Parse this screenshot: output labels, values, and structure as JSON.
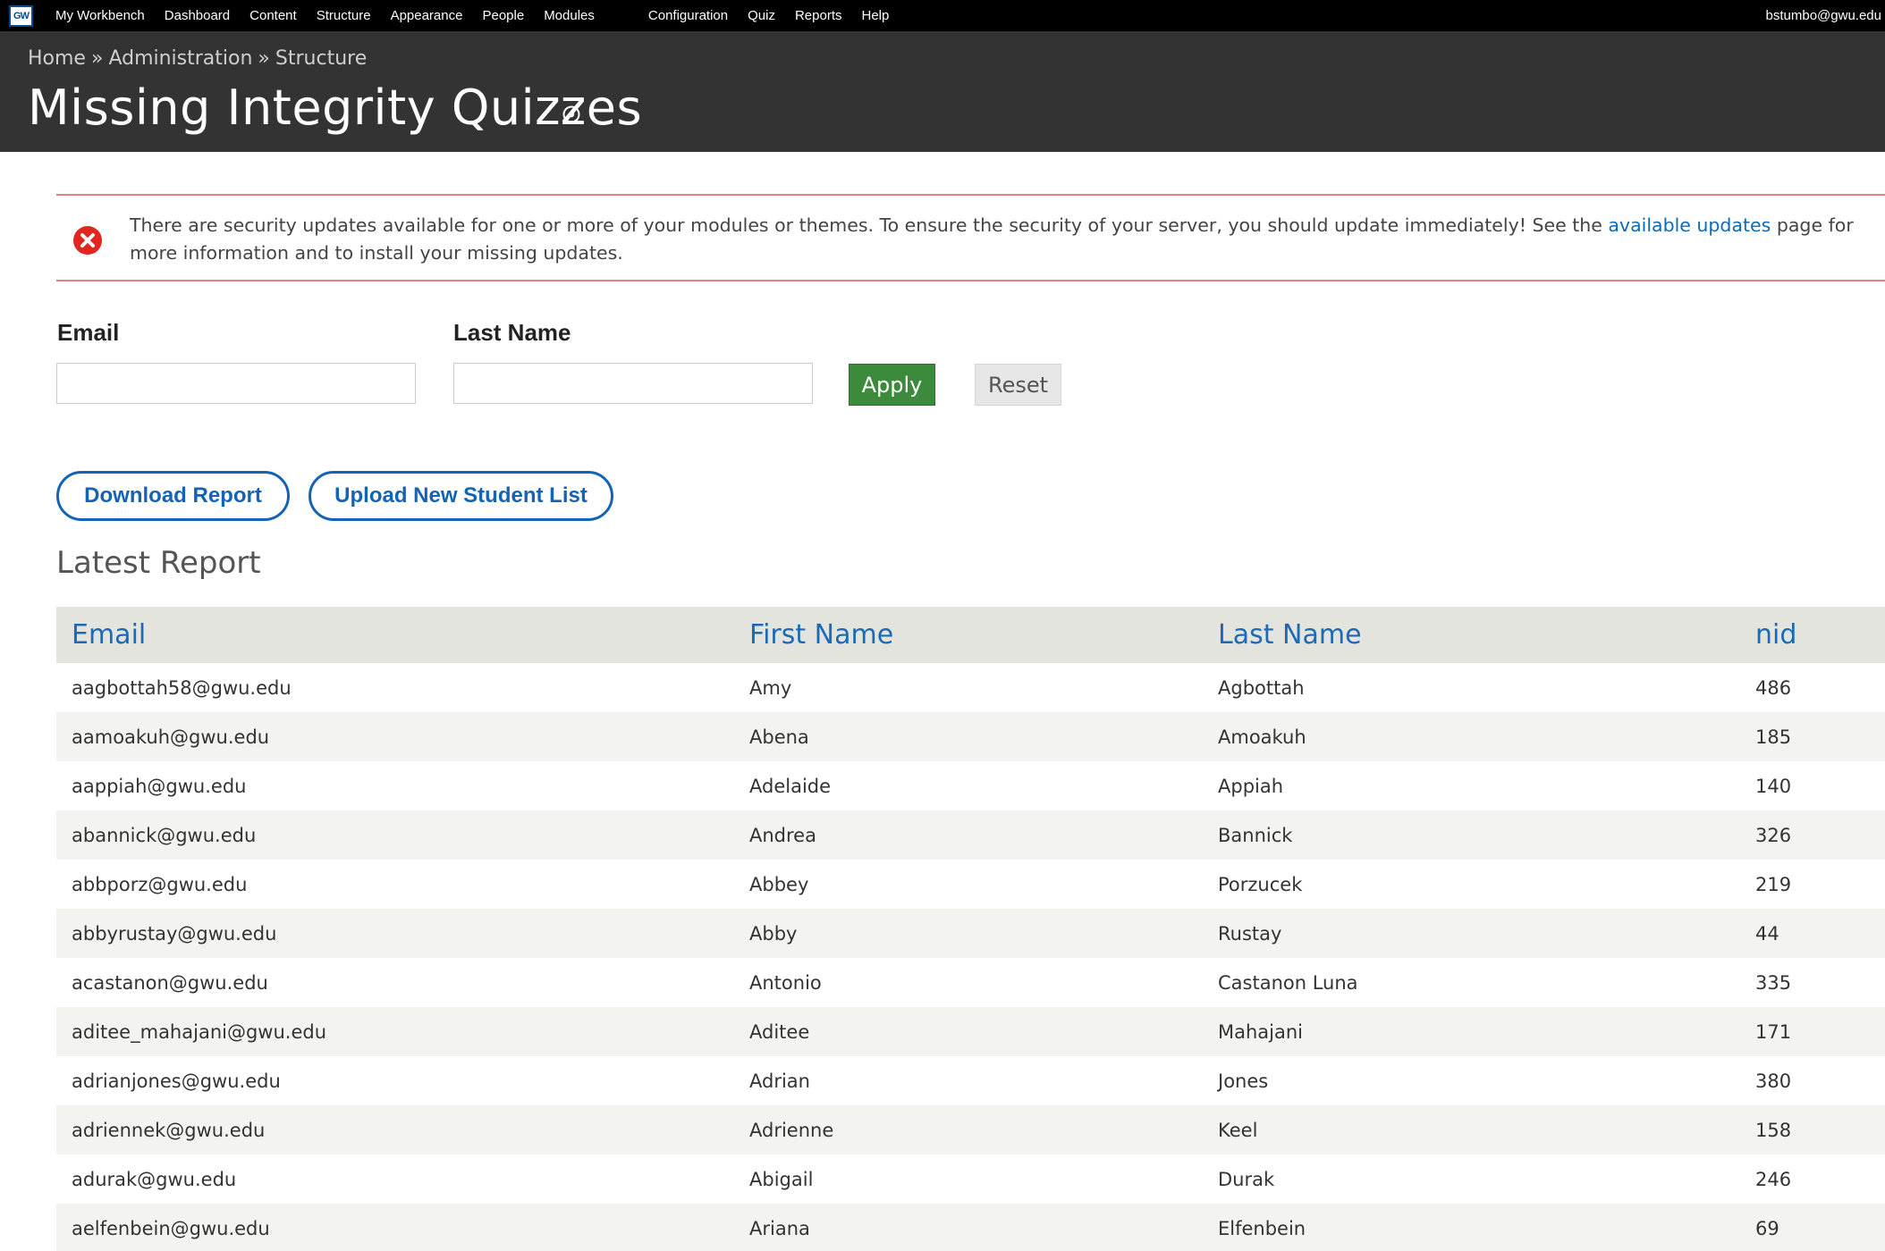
{
  "toolbar": {
    "logo": "GW",
    "items": [
      "My Workbench",
      "Dashboard",
      "Content",
      "Structure",
      "Appearance",
      "People",
      "Modules",
      "Configuration",
      "Quiz",
      "Reports",
      "Help"
    ],
    "user": "bstumbo@gwu.edu"
  },
  "header": {
    "breadcrumb": [
      "Home",
      "Administration",
      "Structure"
    ],
    "breadcrumb_separator": "»",
    "title": "Missing Integrity Quizzes"
  },
  "message": {
    "text_before": "There are security updates available for one or more of your modules or themes. To ensure the security of your server, you should update immediately! See the ",
    "link_text": "available updates",
    "text_after": " page for more information and to install your missing updates."
  },
  "filters": {
    "email_label": "Email",
    "email_value": "",
    "last_name_label": "Last Name",
    "last_name_value": "",
    "apply_label": "Apply",
    "reset_label": "Reset"
  },
  "actions": {
    "download_label": "Download Report",
    "upload_label": "Upload New Student List"
  },
  "report": {
    "title": "Latest Report",
    "columns": [
      "Email",
      "First Name",
      "Last Name",
      "nid"
    ],
    "rows": [
      {
        "email": "aagbottah58@gwu.edu",
        "first": "Amy",
        "last": "Agbottah",
        "nid": "486"
      },
      {
        "email": "aamoakuh@gwu.edu",
        "first": "Abena",
        "last": "Amoakuh",
        "nid": "185"
      },
      {
        "email": "aappiah@gwu.edu",
        "first": "Adelaide",
        "last": "Appiah",
        "nid": "140"
      },
      {
        "email": "abannick@gwu.edu",
        "first": "Andrea",
        "last": "Bannick",
        "nid": "326"
      },
      {
        "email": "abbporz@gwu.edu",
        "first": "Abbey",
        "last": "Porzucek",
        "nid": "219"
      },
      {
        "email": "abbyrustay@gwu.edu",
        "first": "Abby",
        "last": "Rustay",
        "nid": "44"
      },
      {
        "email": "acastanon@gwu.edu",
        "first": "Antonio",
        "last": "Castanon Luna",
        "nid": "335"
      },
      {
        "email": "aditee_mahajani@gwu.edu",
        "first": "Aditee",
        "last": "Mahajani",
        "nid": "171"
      },
      {
        "email": "adrianjones@gwu.edu",
        "first": "Adrian",
        "last": "Jones",
        "nid": "380"
      },
      {
        "email": "adriennek@gwu.edu",
        "first": "Adrienne",
        "last": "Keel",
        "nid": "158"
      },
      {
        "email": "adurak@gwu.edu",
        "first": "Abigail",
        "last": "Durak",
        "nid": "246"
      },
      {
        "email": "aelfenbein@gwu.edu",
        "first": "Ariana",
        "last": "Elfenbein",
        "nid": "69"
      }
    ]
  }
}
